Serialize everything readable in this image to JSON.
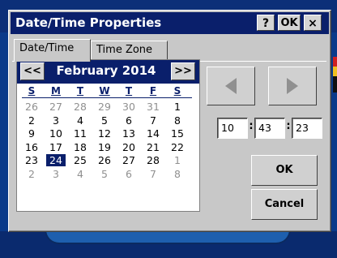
{
  "dialog": {
    "title": "Date/Time Properties",
    "help_label": "?",
    "ok_label": "OK",
    "close_label": "×"
  },
  "tabs": [
    {
      "label": "Date/Time",
      "active": true
    },
    {
      "label": "Time Zone",
      "active": false
    }
  ],
  "calendar": {
    "prev_label": "<<",
    "next_label": ">>",
    "month_label": "February 2014",
    "weekdays": [
      "S",
      "M",
      "T",
      "W",
      "T",
      "F",
      "S"
    ],
    "weeks": [
      [
        {
          "d": "26",
          "o": true
        },
        {
          "d": "27",
          "o": true
        },
        {
          "d": "28",
          "o": true
        },
        {
          "d": "29",
          "o": true
        },
        {
          "d": "30",
          "o": true
        },
        {
          "d": "31",
          "o": true
        },
        {
          "d": "1"
        }
      ],
      [
        {
          "d": "2"
        },
        {
          "d": "3"
        },
        {
          "d": "4"
        },
        {
          "d": "5"
        },
        {
          "d": "6"
        },
        {
          "d": "7"
        },
        {
          "d": "8"
        }
      ],
      [
        {
          "d": "9"
        },
        {
          "d": "10"
        },
        {
          "d": "11"
        },
        {
          "d": "12"
        },
        {
          "d": "13"
        },
        {
          "d": "14"
        },
        {
          "d": "15"
        }
      ],
      [
        {
          "d": "16"
        },
        {
          "d": "17"
        },
        {
          "d": "18"
        },
        {
          "d": "19"
        },
        {
          "d": "20"
        },
        {
          "d": "21"
        },
        {
          "d": "22"
        }
      ],
      [
        {
          "d": "23"
        },
        {
          "d": "24",
          "sel": true
        },
        {
          "d": "25"
        },
        {
          "d": "26"
        },
        {
          "d": "27"
        },
        {
          "d": "28"
        },
        {
          "d": "1",
          "o": true
        }
      ],
      [
        {
          "d": "2",
          "o": true
        },
        {
          "d": "3",
          "o": true
        },
        {
          "d": "4",
          "o": true
        },
        {
          "d": "5",
          "o": true
        },
        {
          "d": "6",
          "o": true
        },
        {
          "d": "7",
          "o": true
        },
        {
          "d": "8",
          "o": true
        }
      ]
    ]
  },
  "time": {
    "hour": "10",
    "minute": "43",
    "second": "23",
    "separator": ":"
  },
  "buttons": {
    "ok_label": "OK",
    "cancel_label": "Cancel"
  },
  "icons": {
    "time_back": "triangle-left-icon",
    "time_forward": "triangle-right-icon"
  },
  "colors": {
    "title_bar": "#0a1f6b",
    "dialog_face": "#c8c8c8",
    "desktop": "#0a3a8a"
  }
}
